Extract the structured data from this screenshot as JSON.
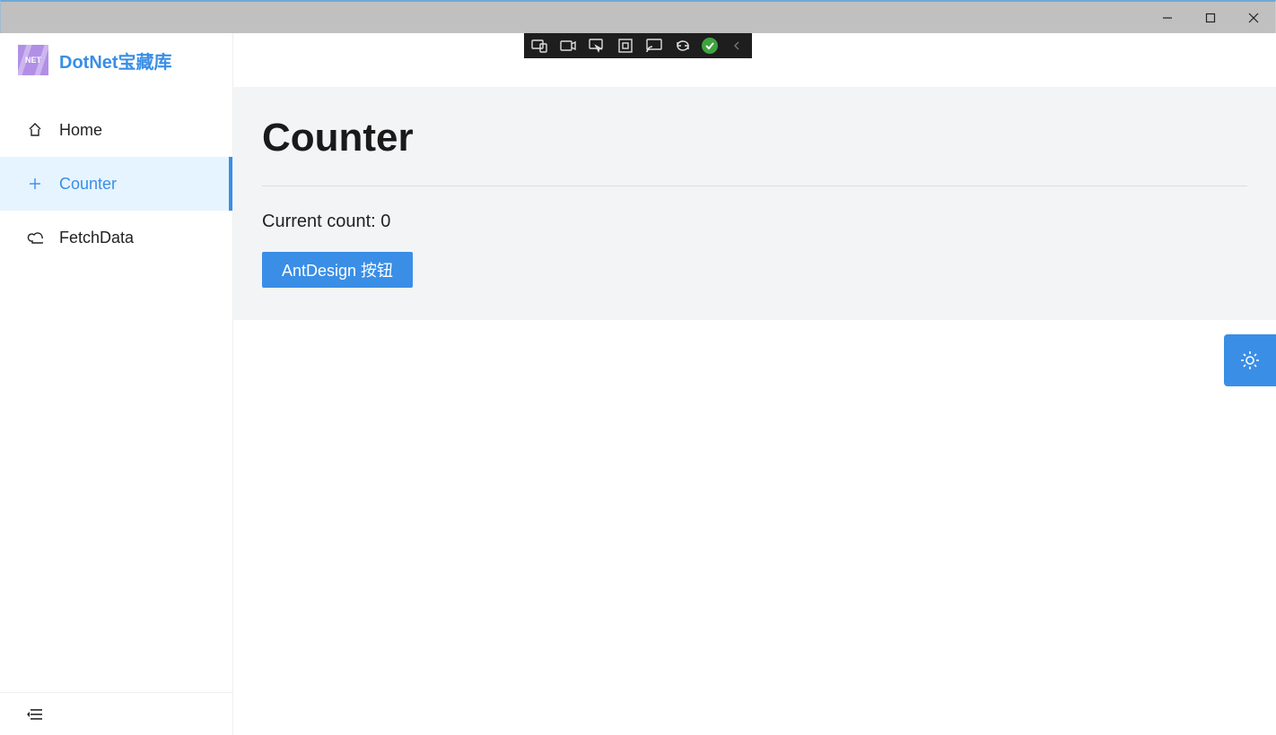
{
  "app": {
    "brand": "DotNet宝藏库",
    "logo_text": "NET"
  },
  "sidebar": {
    "items": [
      {
        "label": "Home",
        "icon": "home-icon",
        "active": false
      },
      {
        "label": "Counter",
        "icon": "plus-icon",
        "active": true
      },
      {
        "label": "FetchData",
        "icon": "cloud-icon",
        "active": false
      }
    ]
  },
  "page": {
    "title": "Counter",
    "count_label": "Current count: ",
    "count_value": "0",
    "button_label": "AntDesign 按钮"
  },
  "dev_toolbar": {
    "icons": [
      "device-preview",
      "camera",
      "pointer",
      "box",
      "cast",
      "sync",
      "ok",
      "collapse"
    ]
  },
  "colors": {
    "accent": "#3a8ee6",
    "titlebar": "#c0c0c0",
    "content_bg": "#f3f4f6"
  }
}
